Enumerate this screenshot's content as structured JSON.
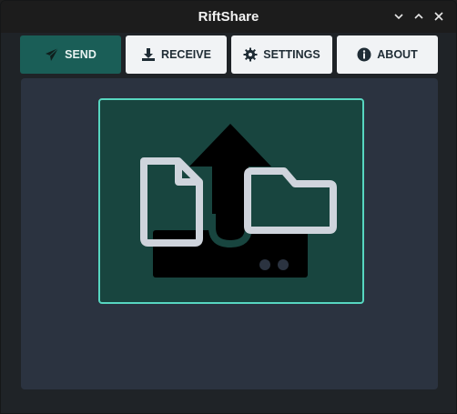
{
  "window": {
    "title": "RiftShare",
    "controls": {
      "minimize_icon": "chevron-down-icon",
      "maximize_icon": "chevron-up-icon",
      "close_icon": "close-icon"
    }
  },
  "tabs": [
    {
      "label": "SEND",
      "icon": "paper-plane-icon",
      "active": true
    },
    {
      "label": "RECEIVE",
      "icon": "download-icon",
      "active": false
    },
    {
      "label": "SETTINGS",
      "icon": "gear-icon",
      "active": false
    },
    {
      "label": "ABOUT",
      "icon": "info-icon",
      "active": false
    }
  ],
  "dropzone": {
    "icons": [
      "upload-arrow-icon",
      "file-icon",
      "folder-icon"
    ]
  },
  "colors": {
    "accent": "#1a5e57",
    "dropzone_bg": "#18453f",
    "dropzone_border": "#57d6c0",
    "panel_bg": "#2b3340",
    "tab_inactive_bg": "#f1f3f5"
  }
}
